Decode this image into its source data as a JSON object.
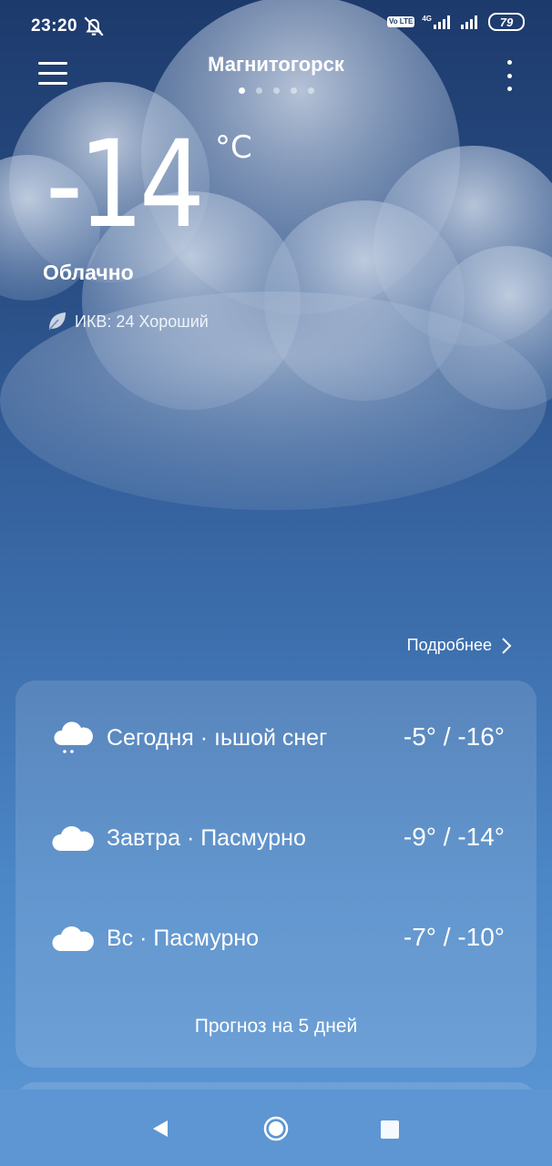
{
  "status_bar": {
    "time": "23:20",
    "network": "4G",
    "volte": "Vo LTE",
    "battery": "79"
  },
  "header": {
    "city": "Магнитогорск",
    "page_dots": 5,
    "active_dot": 0
  },
  "current": {
    "temperature": "-14",
    "unit": "°C",
    "condition": "Облачно",
    "aqi": "ИКВ: 24 Хороший"
  },
  "details_link": "Подробнее",
  "forecast": [
    {
      "icon": "snow-cloud-icon",
      "label": "Сегодня · ıьшой снег",
      "range": "-5° / -16°"
    },
    {
      "icon": "cloud-icon",
      "label": "Завтра · Пасмурно",
      "range": "-9° / -14°"
    },
    {
      "icon": "cloud-icon",
      "label": "Вс · Пасмурно",
      "range": "-7° / -10°"
    }
  ],
  "forecast_button": "Прогноз на 5 дней",
  "colors": {
    "bg_top": "#1d3a6c",
    "bg_bottom": "#5d98d6"
  }
}
